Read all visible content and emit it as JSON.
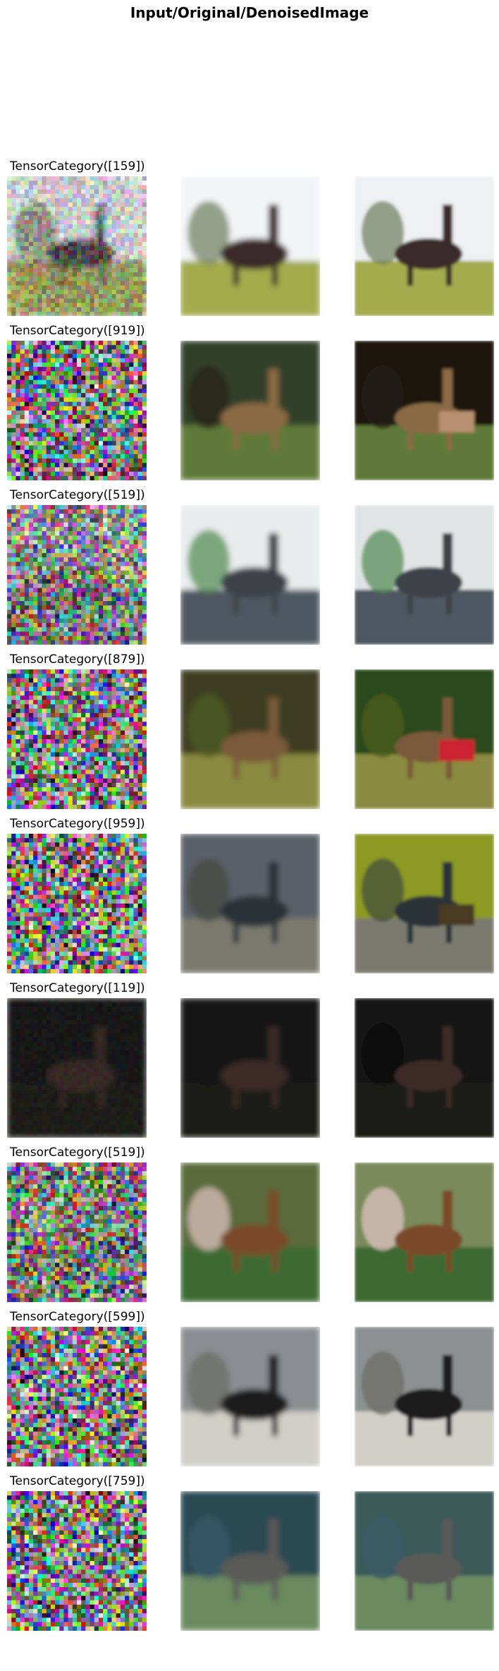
{
  "figure": {
    "title": "Input/Original/DenoisedImage"
  },
  "rows": [
    {
      "label": "TensorCategory([159])",
      "noise": 0.35,
      "dark": false,
      "scene": {
        "sky": "#f3f4f6",
        "ground": "#a3ab4e",
        "subject": "#3a2a2a",
        "accent": "#6c7c5c",
        "blur2": "#eef0f2"
      }
    },
    {
      "label": "TensorCategory([919])",
      "noise": 1.0,
      "dark": false,
      "scene": {
        "sky": "#33402a",
        "ground": "#5f7a38",
        "subject": "#8a6a44",
        "accent": "#2a2418",
        "blur2": "#1a1410",
        "alt": "#b89070"
      }
    },
    {
      "label": "TensorCategory([519])",
      "noise": 0.8,
      "dark": false,
      "scene": {
        "sky": "#e8ecec",
        "ground": "#4f5862",
        "subject": "#3d434a",
        "accent": "#4f8a4f",
        "blur2": "#e0e4e4"
      }
    },
    {
      "label": "TensorCategory([879])",
      "noise": 1.0,
      "dark": false,
      "scene": {
        "sky": "#3e3d24",
        "ground": "#8a8a40",
        "subject": "#7a5a3a",
        "accent": "#506020",
        "blur2": "#2a4a1a",
        "alt": "#cc2233"
      }
    },
    {
      "label": "TensorCategory([959])",
      "noise": 1.0,
      "dark": false,
      "scene": {
        "sky": "#5a6068",
        "ground": "#7a7a70",
        "subject": "#2c3038",
        "accent": "#404a40",
        "blur2": "#8a9a20",
        "alt": "#4a3a20"
      }
    },
    {
      "label": "TensorCategory([119])",
      "noise": 0.15,
      "dark": true,
      "scene": {
        "sky": "#151515",
        "ground": "#1c1a18",
        "subject": "#3a2c28",
        "accent": "#111111",
        "blur2": "#131313"
      }
    },
    {
      "label": "TensorCategory([519])",
      "noise": 0.85,
      "dark": false,
      "scene": {
        "sky": "#5a6a3a",
        "ground": "#3e6a30",
        "subject": "#7a4a2a",
        "accent": "#e6c8c8",
        "blur2": "#7a8a5a"
      }
    },
    {
      "label": "TensorCategory([599])",
      "noise": 1.0,
      "dark": false,
      "scene": {
        "sky": "#8a8e90",
        "ground": "#d0cfc8",
        "subject": "#1c1a1a",
        "accent": "#6a6a64",
        "blur2": "#8c9090"
      }
    },
    {
      "label": "TensorCategory([759])",
      "noise": 1.0,
      "dark": false,
      "scene": {
        "sky": "#2a4a52",
        "ground": "#6a8a60",
        "subject": "#5a5a58",
        "accent": "#3a5a6a",
        "blur2": "#3a5a58"
      }
    }
  ],
  "columns": [
    "input-image",
    "original-image",
    "denoised-image"
  ]
}
